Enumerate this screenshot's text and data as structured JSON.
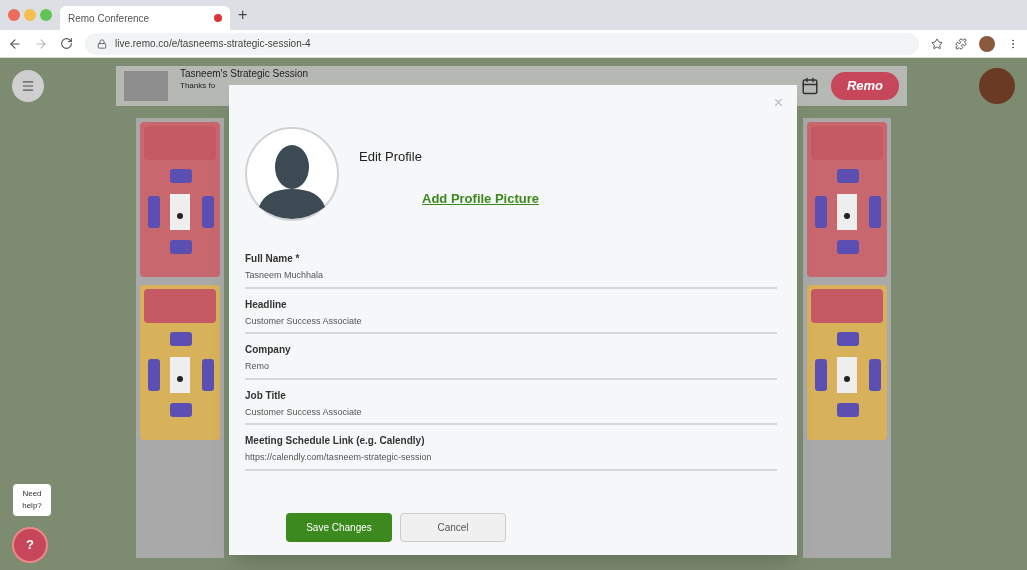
{
  "browser": {
    "tab": {
      "title": "Remo Conference",
      "selected": true
    },
    "url": "live.remo.co/e/tasneems-strategic-session-4"
  },
  "event": {
    "title": "Tasneem's Strategic Session",
    "subtitle": "Thanks fo",
    "logo": "Remo"
  },
  "tables": [
    {
      "color": "#c9676f"
    },
    {
      "color": "#d7b25a"
    },
    {
      "color": "#c9676f"
    },
    {
      "color": "#d7b25a"
    }
  ],
  "modal": {
    "title": "Edit Profile",
    "photo_link": "Add Profile Picture",
    "close": "×",
    "fields": [
      {
        "label": "Full Name *",
        "value": "Tasneem Muchhala"
      },
      {
        "label": "Headline",
        "value": "Customer Success Associate"
      },
      {
        "label": "Company",
        "value": "Remo"
      },
      {
        "label": "Job Title",
        "value": "Customer Success Associate"
      },
      {
        "label": "Meeting Schedule Link (e.g. Calendly)",
        "value": "https://calendly.com/tasneem-strategic-session"
      }
    ],
    "buttons": [
      {
        "label": "Save Changes",
        "kind": "primary"
      },
      {
        "label": "Cancel",
        "kind": "secondary"
      }
    ]
  },
  "help": {
    "label": "Need help?",
    "icon": "?"
  },
  "new_tab": "+"
}
